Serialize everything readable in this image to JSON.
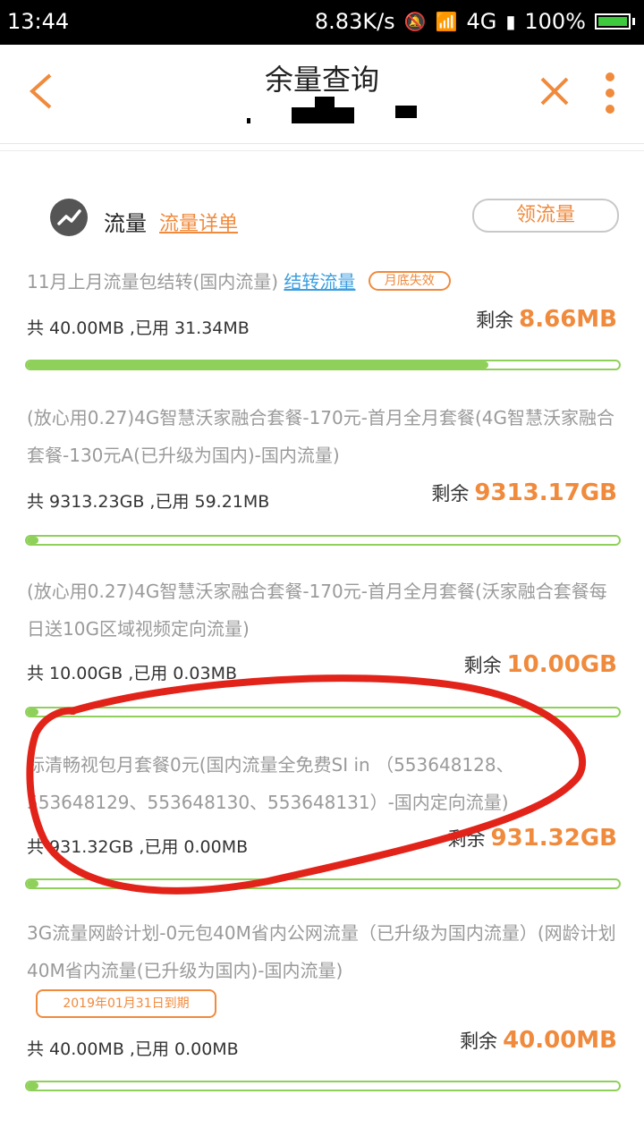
{
  "status": {
    "time": "13:44",
    "speed": "8.83K/s",
    "network": "4G",
    "battery": "100%"
  },
  "header": {
    "title": "余量查询"
  },
  "section": {
    "title": "流量",
    "detail_link": "流量详单",
    "get_button": "领流量"
  },
  "items": [
    {
      "name": "11月上月流量包结转(国内流量)",
      "link": "结转流量",
      "badge": "月底失效",
      "usage": "共 40.00MB ,已用 31.34MB",
      "remain_label": "剩余",
      "remain_value": "8.66MB",
      "progress": 0.78
    },
    {
      "name": "(放心用0.27)4G智慧沃家融合套餐-170元-首月全月套餐(4G智慧沃家融合套餐-130元A(已升级为国内)-国内流量)",
      "usage": "共 9313.23GB ,已用 59.21MB",
      "remain_label": "剩余",
      "remain_value": "9313.17GB",
      "progress": 0.02
    },
    {
      "name": "(放心用0.27)4G智慧沃家融合套餐-170元-首月全月套餐(沃家融合套餐每日送10G区域视频定向流量)",
      "usage": "共 10.00GB ,已用 0.03MB",
      "remain_label": "剩余",
      "remain_value": "10.00GB",
      "progress": 0.02
    },
    {
      "name": "标清畅视包月套餐0元(国内流量全免费SI in （553648128、553648129、553648130、553648131）-国内定向流量)",
      "usage": "共 931.32GB ,已用 0.00MB",
      "remain_label": "剩余",
      "remain_value": "931.32GB",
      "progress": 0.02
    },
    {
      "name": "3G流量网龄计划-0元包40M省内公网流量（已升级为国内流量）(网龄计划40M省内流量(已升级为国内)-国内流量)",
      "date_badge": "2019年01月31日到期",
      "usage": "共 40.00MB ,已用 0.00MB",
      "remain_label": "剩余",
      "remain_value": "40.00MB",
      "progress": 0.02
    }
  ]
}
